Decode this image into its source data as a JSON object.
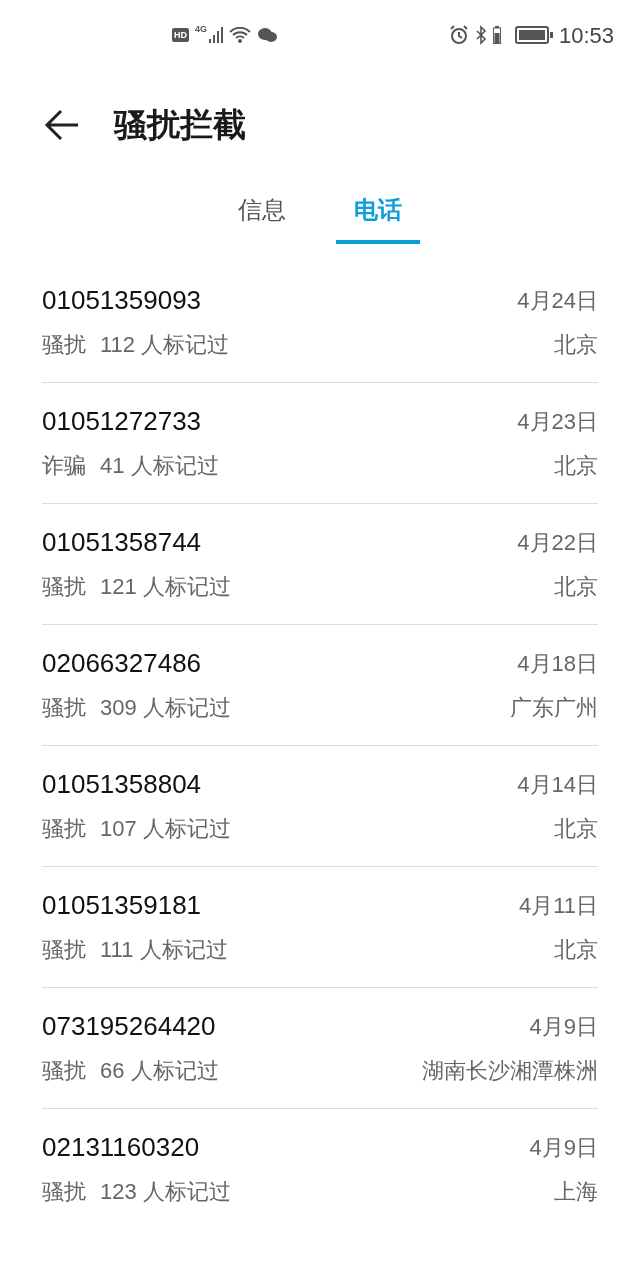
{
  "status_bar": {
    "hd": "HD",
    "network": "4G",
    "time": "10:53"
  },
  "header": {
    "title": "骚扰拦截"
  },
  "tabs": [
    {
      "label": "信息",
      "selected": false
    },
    {
      "label": "电话",
      "selected": true
    }
  ],
  "calls": [
    {
      "number": "01051359093",
      "tag": "骚扰",
      "marks": "112 人标记过",
      "date": "4月24日",
      "location": "北京"
    },
    {
      "number": "01051272733",
      "tag": "诈骗",
      "marks": "41 人标记过",
      "date": "4月23日",
      "location": "北京"
    },
    {
      "number": "01051358744",
      "tag": "骚扰",
      "marks": "121 人标记过",
      "date": "4月22日",
      "location": "北京"
    },
    {
      "number": "02066327486",
      "tag": "骚扰",
      "marks": "309 人标记过",
      "date": "4月18日",
      "location": "广东广州"
    },
    {
      "number": "01051358804",
      "tag": "骚扰",
      "marks": "107 人标记过",
      "date": "4月14日",
      "location": "北京"
    },
    {
      "number": "01051359181",
      "tag": "骚扰",
      "marks": "111 人标记过",
      "date": "4月11日",
      "location": "北京"
    },
    {
      "number": "073195264420",
      "tag": "骚扰",
      "marks": "66 人标记过",
      "date": "4月9日",
      "location": "湖南长沙湘潭株洲"
    },
    {
      "number": "02131160320",
      "tag": "骚扰",
      "marks": "123 人标记过",
      "date": "4月9日",
      "location": "上海"
    }
  ]
}
